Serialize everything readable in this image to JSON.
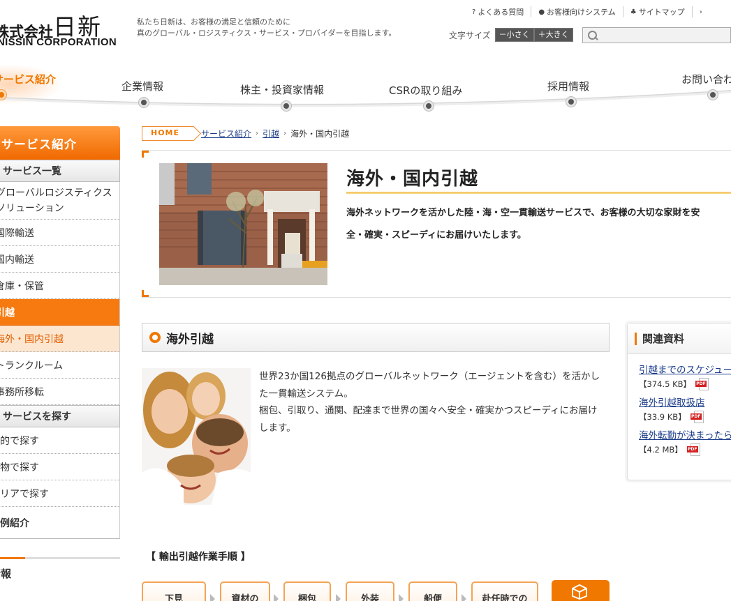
{
  "header": {
    "logo_jp_prefix": "株式会社",
    "logo_jp_name": "日新",
    "logo_en": "NISSIN CORPORATION",
    "tagline_line1": "私たち日新は、お客様の満足と信頼のために",
    "tagline_line2": "真のグローバル・ロジスティクス・サービス・プロバイダーを目指します。",
    "utility": [
      {
        "icon": "question-icon",
        "glyph": "?",
        "label": "よくある質問"
      },
      {
        "icon": "person-icon",
        "glyph": "●",
        "label": "お客様向けシステム"
      },
      {
        "icon": "sitemap-icon",
        "glyph": "♣",
        "label": "サイトマップ"
      },
      {
        "icon": "chevron-right-icon",
        "glyph": "›",
        "label": ""
      }
    ],
    "font_size_label": "文字サイズ",
    "font_small": "－小さく",
    "font_large": "＋大きく",
    "search_placeholder": ""
  },
  "gnav": [
    {
      "label": "サービス紹介",
      "active": true
    },
    {
      "label": "企業情報",
      "active": false
    },
    {
      "label": "株主・投資家情報",
      "active": false
    },
    {
      "label": "CSRの取り組み",
      "active": false
    },
    {
      "label": "採用情報",
      "active": false
    },
    {
      "label": "お問い合わせ",
      "active": false
    }
  ],
  "side": {
    "head": "サービス紹介",
    "list_head": "サービス一覧",
    "items": [
      "グローバルロジスティクスソリューション",
      "国際輸送",
      "国内輸送",
      "倉庫・保管",
      "引越",
      "海外・国内引越",
      "トランクルーム",
      "事務所移転"
    ],
    "search_head": "サービスを探す",
    "search_items": [
      "目的で探す",
      "貨物で探す",
      "エリアで探す"
    ],
    "case": "事例紹介",
    "info": "情報"
  },
  "breadcrumb": {
    "home": "HOME",
    "items": [
      "サービス紹介",
      "引越"
    ],
    "current": "海外・国内引越"
  },
  "hero": {
    "title": "海外・国内引越",
    "lead1": "海外ネットワークを活かした陸・海・空一貫輸送サービスで、お客様の大切な家財を安",
    "lead2": "全・確実・スピーディにお届けいたします。"
  },
  "section": {
    "title": "海外引越",
    "body1": "世界23か国126拠点のグローバルネットワーク（エージェントを含む）を活かした一貫輸送システム。",
    "body2": "梱包、引取り、通関、配達まで世界の国々へ安全・確実かつスピーディにお届けします。"
  },
  "steps": {
    "title": "【 輸出引越作業手順 】",
    "items": [
      "下見",
      "資材の",
      "梱包",
      "外装",
      "船便",
      "赴任時での"
    ]
  },
  "related": {
    "title": "関連資料",
    "items": [
      {
        "label": "引越までのスケジュール",
        "size": "【374.5 KB】"
      },
      {
        "label": "海外引越取扱店",
        "size": "【33.9 KB】"
      },
      {
        "label": "海外転勤が決まったら",
        "size": "【4.2 MB】"
      }
    ]
  },
  "colors": {
    "accent": "#f07800",
    "link": "#1c3d8a"
  }
}
